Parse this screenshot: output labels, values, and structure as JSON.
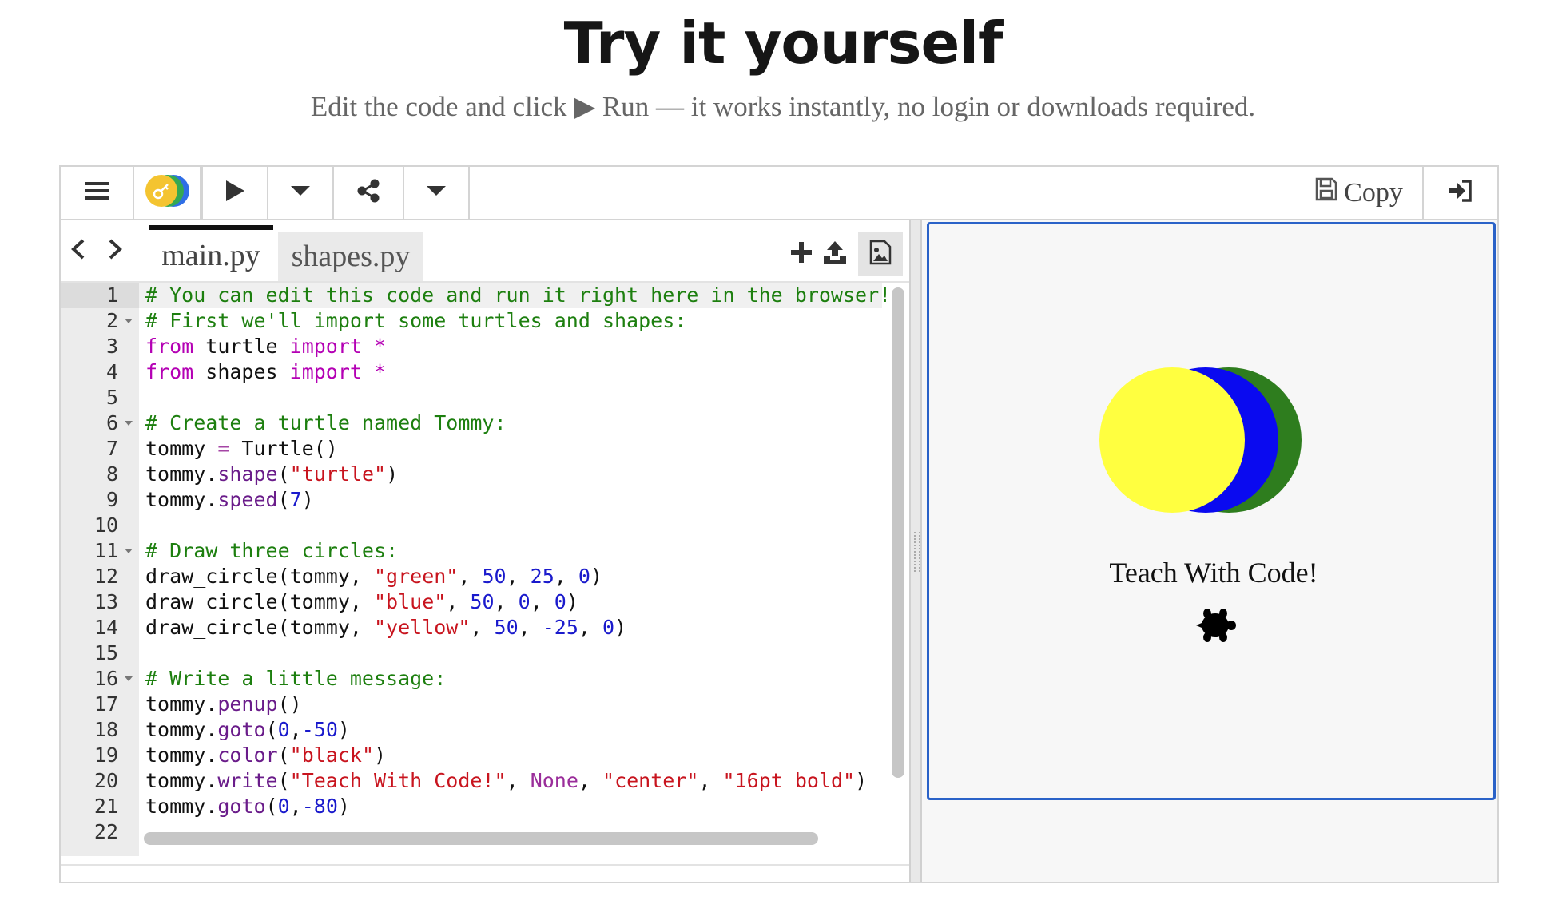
{
  "header": {
    "title": "Try it yourself",
    "subtitle": "Edit the code and click ▶ Run — it works instantly, no login or downloads required."
  },
  "toolbar": {
    "menu_icon": "hamburger-menu-icon",
    "theme_icon": "key-toggle-icon",
    "run_icon": "play-icon",
    "run_options_icon": "caret-down-icon",
    "share_icon": "share-icon",
    "share_options_icon": "caret-down-icon",
    "copy_label": "Copy",
    "copy_icon": "save-icon",
    "signin_icon": "sign-in-icon"
  },
  "editor": {
    "tabs": [
      {
        "label": "main.py",
        "active": true
      },
      {
        "label": "shapes.py",
        "active": false
      }
    ],
    "tools": [
      "plus-icon",
      "upload-icon",
      "image-icon"
    ],
    "lines": [
      {
        "n": "1",
        "fold": false,
        "text": "# You can edit this code and run it right here in the browser!"
      },
      {
        "n": "2",
        "fold": true,
        "text": "# First we'll import some turtles and shapes:"
      },
      {
        "n": "3",
        "fold": false,
        "text": "from turtle import *"
      },
      {
        "n": "4",
        "fold": false,
        "text": "from shapes import *"
      },
      {
        "n": "5",
        "fold": false,
        "text": ""
      },
      {
        "n": "6",
        "fold": true,
        "text": "# Create a turtle named Tommy:"
      },
      {
        "n": "7",
        "fold": false,
        "text": "tommy = Turtle()"
      },
      {
        "n": "8",
        "fold": false,
        "text": "tommy.shape(\"turtle\")"
      },
      {
        "n": "9",
        "fold": false,
        "text": "tommy.speed(7)"
      },
      {
        "n": "10",
        "fold": false,
        "text": ""
      },
      {
        "n": "11",
        "fold": true,
        "text": "# Draw three circles:"
      },
      {
        "n": "12",
        "fold": false,
        "text": "draw_circle(tommy, \"green\", 50, 25, 0)"
      },
      {
        "n": "13",
        "fold": false,
        "text": "draw_circle(tommy, \"blue\", 50, 0, 0)"
      },
      {
        "n": "14",
        "fold": false,
        "text": "draw_circle(tommy, \"yellow\", 50, -25, 0)"
      },
      {
        "n": "15",
        "fold": false,
        "text": ""
      },
      {
        "n": "16",
        "fold": true,
        "text": "# Write a little message:"
      },
      {
        "n": "17",
        "fold": false,
        "text": "tommy.penup()"
      },
      {
        "n": "18",
        "fold": false,
        "text": "tommy.goto(0,-50)"
      },
      {
        "n": "19",
        "fold": false,
        "text": "tommy.color(\"black\")"
      },
      {
        "n": "20",
        "fold": false,
        "text": "tommy.write(\"Teach With Code!\", None, \"center\", \"16pt bold\")"
      },
      {
        "n": "21",
        "fold": false,
        "text": "tommy.goto(0,-80)"
      },
      {
        "n": "22",
        "fold": false,
        "text": ""
      }
    ],
    "active_line": "1"
  },
  "output": {
    "message": "Teach With Code!",
    "circle_colors": [
      "#2e7d1e",
      "#0a0af0",
      "#ffff40"
    ],
    "turtle_icon": "turtle-icon"
  },
  "colors": {
    "accent_border": "#2a62c8",
    "comment": "#1d7f0f",
    "keyword": "#b400b4",
    "string": "#c8141e",
    "number": "#1a1acc"
  }
}
